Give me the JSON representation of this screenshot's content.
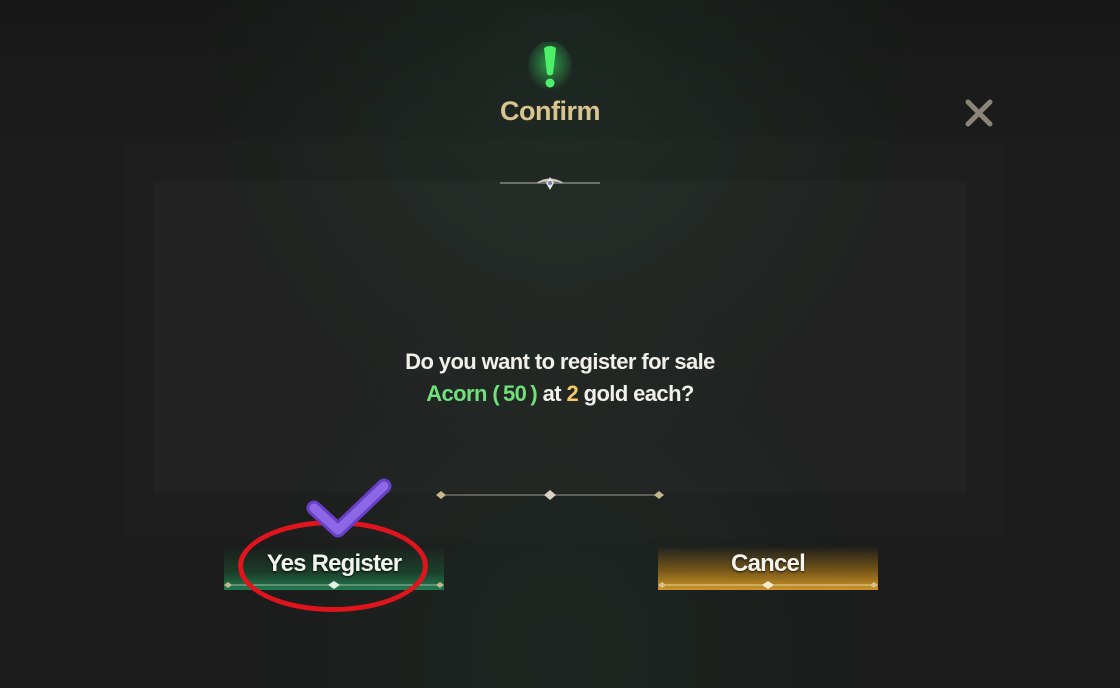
{
  "dialog": {
    "title": "Confirm",
    "message_line1": "Do you want to register for sale",
    "item_name": "Acorn",
    "item_qty_open": "(",
    "item_qty": "50",
    "item_qty_close": ")",
    "word_at": "at",
    "price": "2",
    "price_suffix": "gold each?"
  },
  "buttons": {
    "confirm_label": "Yes Register",
    "cancel_label": "Cancel"
  },
  "icons": {
    "alert": "exclamation-icon",
    "close": "close-icon",
    "annotation_check": "checkmark-icon"
  },
  "colors": {
    "title": "#d9c391",
    "item_highlight": "#6fe07a",
    "price_highlight": "#f5c86a",
    "confirm_glow": "#28c878",
    "cancel_glow": "#ebaa28",
    "annotation_circle": "#e0141c",
    "annotation_check": "#7d55d8"
  }
}
